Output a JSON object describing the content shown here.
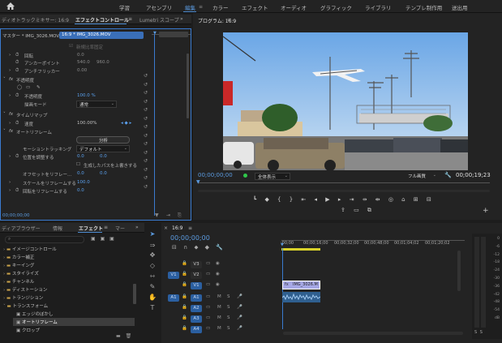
{
  "workspace_tabs": [
    "学習",
    "アセンブリ",
    "編集",
    "カラー",
    "エフェクト",
    "オーディオ",
    "グラフィック",
    "ライブラリ",
    "テンプレ制作用",
    "送出用"
  ],
  "active_workspace": "編集",
  "effect_panel": {
    "tabs": [
      "ディオトラックミキサー: 16:9",
      "エフェクトコントロール",
      "Lumetri スコープ"
    ],
    "master_label": "マスター * IMG_3026.MOV",
    "clip_label": "16:9 * IMG_3026.MOV",
    "disabled_checkbox": "新規比率固定",
    "rows": [
      {
        "label": "回転",
        "value": "0.0"
      },
      {
        "label": "アンカーポイント",
        "value": "540.0",
        "value2": "960.0"
      },
      {
        "label": "アンチフリッカー",
        "value": "0.00"
      }
    ],
    "opacity": {
      "header": "不透明度",
      "label": "不透明度",
      "value": "100.0 %",
      "blend_label": "描画モード",
      "blend_value": "通常"
    },
    "timeremap": {
      "header": "タイムリマップ",
      "label": "速度",
      "value": "100.00%"
    },
    "autoreframe": {
      "header": "オートリフレーム",
      "analyze": "分析",
      "motion_label": "モーショントラッキング",
      "motion_value": "デフォルト",
      "pos_label": "位置を調整する",
      "pos_v1": "0.0",
      "pos_v2": "0.0",
      "override": "生成したパスを上書きする",
      "offset_label": "オフセットをリフレー...",
      "offset_v1": "0.0",
      "offset_v2": "0.0",
      "scale_label": "スケールをリフレームする",
      "scale_value": "100.0",
      "rot_label": "回転をリフレームする",
      "rot_value": "0.0"
    },
    "timecode": "00;00;00;00"
  },
  "program": {
    "title": "プログラム: 16:9",
    "timecode": "00;00;00;00",
    "fit": "全体表示",
    "quality": "フル画質",
    "duration": "00;00;19;23"
  },
  "project": {
    "tabs": [
      "ディアブラウザー",
      "情報",
      "エフェクト",
      "マー"
    ],
    "items": [
      {
        "label": "イメージコントロール",
        "type": "folder"
      },
      {
        "label": "カラー補正",
        "type": "folder"
      },
      {
        "label": "キーイング",
        "type": "folder"
      },
      {
        "label": "スタイライズ",
        "type": "folder"
      },
      {
        "label": "チャンネル",
        "type": "folder"
      },
      {
        "label": "ディストーション",
        "type": "folder"
      },
      {
        "label": "トランジション",
        "type": "folder"
      },
      {
        "label": "トランスフォーム",
        "type": "folder-open"
      },
      {
        "label": "エッジのぼかし",
        "type": "effect"
      },
      {
        "label": "オートリフレーム",
        "type": "effect"
      },
      {
        "label": "クロップ",
        "type": "effect"
      }
    ]
  },
  "timeline": {
    "tab": "16:9",
    "timecode": "00;00;00;00",
    "ruler": [
      ";00;00",
      "00;00;16;00",
      "00;00;32;00",
      "00;00;48;00",
      "00;01;04;02",
      "00;01;20;02"
    ],
    "video_tracks": [
      "V3",
      "V2",
      "V1"
    ],
    "audio_tracks": [
      "A1",
      "A2",
      "A3",
      "A4"
    ],
    "src_v": "V1",
    "src_a": "A1",
    "clip_name": "IMG_3026.M",
    "meter_ticks": [
      "0",
      "-6",
      "-12",
      "-18",
      "-24",
      "-30",
      "-36",
      "-42",
      "-48",
      "-54",
      "dB"
    ],
    "meter_bottom": [
      "S",
      "S"
    ]
  }
}
